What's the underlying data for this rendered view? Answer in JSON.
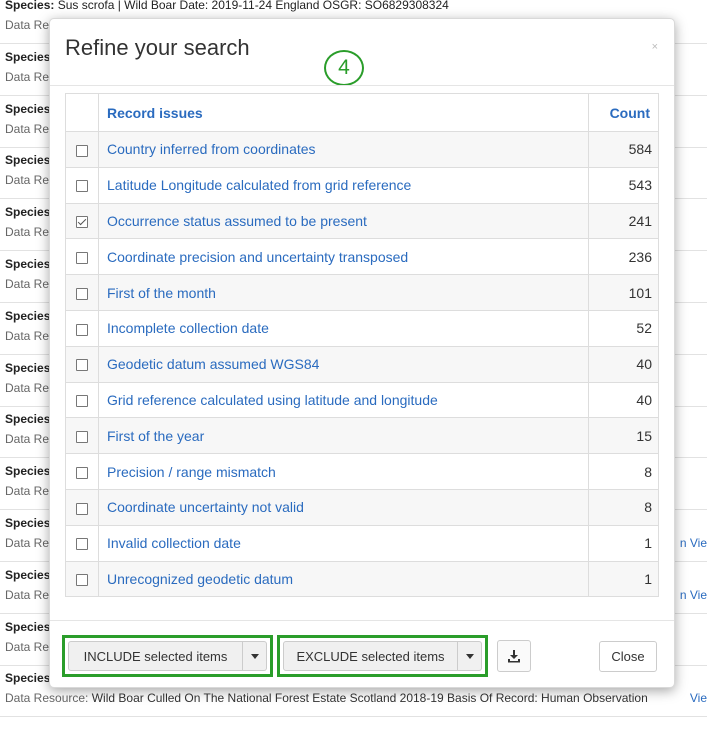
{
  "background": {
    "items": [
      {
        "species_label": "Species:",
        "species_value": "Sus scrofa | Wild Boar  Date: 2019-11-24  England  OSGR: SO6829308324",
        "datares_label": "Data Re",
        "datares_value": "",
        "view": ""
      },
      {
        "species_label": "Species",
        "species_value": "",
        "datares_label": "Data Re",
        "datares_value": "",
        "view": ""
      },
      {
        "species_label": "Species",
        "species_value": "",
        "datares_label": "Data Re",
        "datares_value": "",
        "view": ""
      },
      {
        "species_label": "Species",
        "species_value": "",
        "datares_label": "Data Re",
        "datares_value": "",
        "view": ""
      },
      {
        "species_label": "Species",
        "species_value": "",
        "datares_label": "Data Re",
        "datares_value": "",
        "view": ""
      },
      {
        "species_label": "Species",
        "species_value": "",
        "datares_label": "Data Re",
        "datares_value": "",
        "view": ""
      },
      {
        "species_label": "Species",
        "species_value": "",
        "datares_label": "Data Re",
        "datares_value": "",
        "view": ""
      },
      {
        "species_label": "Species",
        "species_value": "",
        "datares_label": "Data Re",
        "datares_value": "",
        "view": ""
      },
      {
        "species_label": "Species",
        "species_value": "",
        "datares_label": "Data Re",
        "datares_value": "",
        "view": ""
      },
      {
        "species_label": "Species",
        "species_value": "",
        "datares_label": "Data Re",
        "datares_value": "",
        "view": ""
      },
      {
        "species_label": "Species",
        "species_value": "",
        "datares_label": "Data Re",
        "datares_value": "",
        "view": "n  Vie"
      },
      {
        "species_label": "Species",
        "species_value": "",
        "datares_label": "Data Re",
        "datares_value": "",
        "view": "n  Vie"
      },
      {
        "species_label": "Species",
        "species_value": "",
        "datares_label": "Data Re",
        "datares_value": "",
        "view": ""
      },
      {
        "species_label": "Species",
        "species_value": "",
        "datares_label": "Data Resource:",
        "datares_value": "Wild Boar Culled On The National Forest Estate Scotland 2018-19  Basis Of Record:  Human Observation",
        "view": "Vie"
      }
    ]
  },
  "modal": {
    "title": "Refine your search",
    "close_glyph": "×",
    "step_badge": "4",
    "table": {
      "headers": {
        "issue": "Record issues",
        "count": "Count"
      },
      "rows": [
        {
          "label": "Country inferred from coordinates",
          "count": "584",
          "checked": false
        },
        {
          "label": "Latitude Longitude calculated from grid reference",
          "count": "543",
          "checked": false
        },
        {
          "label": "Occurrence status assumed to be present",
          "count": "241",
          "checked": true
        },
        {
          "label": "Coordinate precision and uncertainty transposed",
          "count": "236",
          "checked": false
        },
        {
          "label": "First of the month",
          "count": "101",
          "checked": false
        },
        {
          "label": "Incomplete collection date",
          "count": "52",
          "checked": false
        },
        {
          "label": "Geodetic datum assumed WGS84",
          "count": "40",
          "checked": false
        },
        {
          "label": "Grid reference calculated using latitude and longitude",
          "count": "40",
          "checked": false
        },
        {
          "label": "First of the year",
          "count": "15",
          "checked": false
        },
        {
          "label": "Precision / range mismatch",
          "count": "8",
          "checked": false
        },
        {
          "label": "Coordinate uncertainty not valid",
          "count": "8",
          "checked": false
        },
        {
          "label": "Invalid collection date",
          "count": "1",
          "checked": false
        },
        {
          "label": "Unrecognized geodetic datum",
          "count": "1",
          "checked": false
        }
      ]
    },
    "footer": {
      "include_label": "INCLUDE selected items",
      "exclude_label": "EXCLUDE selected items",
      "download_icon": "download-icon",
      "close_label": "Close"
    }
  },
  "colors": {
    "link": "#2a6bbf",
    "highlight_green": "#2a9d2a"
  }
}
